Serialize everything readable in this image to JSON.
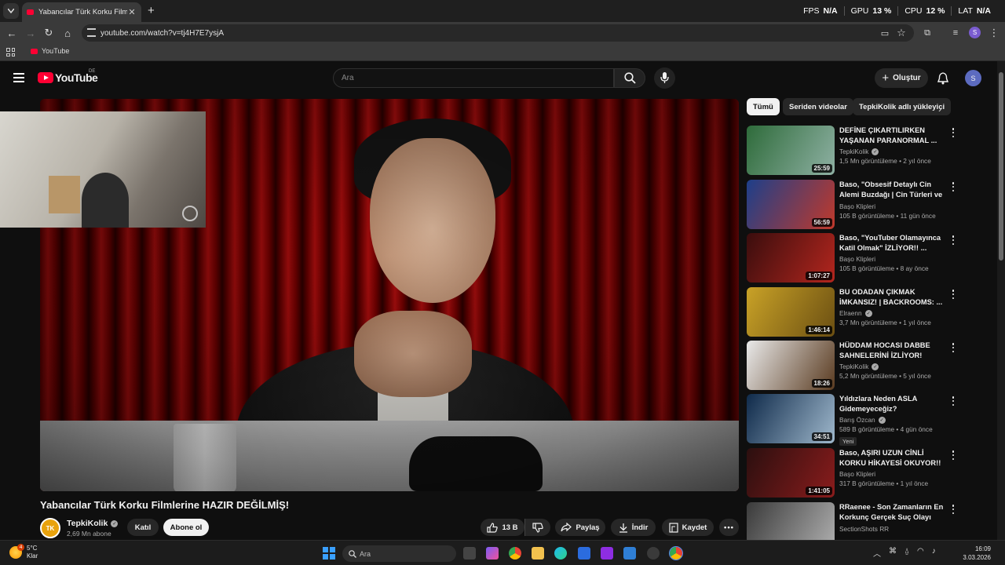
{
  "browser": {
    "tab_title": "Yabancılar Türk Korku Filmlerine HAZIR DEĞİLMİŞ!",
    "url": "youtube.com/watch?v=tj4H7E7ysjA",
    "profile_initial": "S",
    "bookmark_label": "YouTube",
    "perf": [
      {
        "label": "FPS",
        "value": "N/A"
      },
      {
        "label": "GPU",
        "value": "13 %"
      },
      {
        "label": "CPU",
        "value": "12 %"
      },
      {
        "label": "LAT",
        "value": "N/A"
      }
    ]
  },
  "youtube": {
    "logo_text": "YouTube",
    "country_code": "DE",
    "search_placeholder": "Ara",
    "create_label": "Oluştur",
    "avatar_initial": "S"
  },
  "video": {
    "title": "Yabancılar Türk Korku Filmlerine HAZIR DEĞİLMİŞ!",
    "channel": "TepkiKolik",
    "channel_initials": "TK",
    "subscribers": "2,69 Mn abone",
    "join_label": "Katıl",
    "subscribe_label": "Abone ol",
    "likes": "13 B",
    "share_label": "Paylaş",
    "download_label": "İndir",
    "save_label": "Kaydet"
  },
  "chips": [
    "Tümü",
    "Seriden videolar",
    "TepkiKolik adlı yükleyici"
  ],
  "recommendations": [
    {
      "title": "DEFİNE ÇIKARTILIRKEN YAŞANAN PARANORMAL ...",
      "channel": "TepkiKolik",
      "verified": true,
      "stats": "1,5 Mn görüntüleme • 2 yıl önce",
      "duration": "25:59",
      "badge": "",
      "color_a": "#2e6b3a",
      "color_b": "#8fb1a4"
    },
    {
      "title": "Baso, \"Obsesif Detaylı Cin Alemi Buzdağı | Cin Türleri ve ...",
      "channel": "Başo Klipleri",
      "verified": false,
      "stats": "105 B görüntüleme • 11 gün önce",
      "duration": "56:59",
      "badge": "",
      "color_a": "#1d3f8a",
      "color_b": "#c0392b"
    },
    {
      "title": "Baso, \"YouTuber Olamayınca Katil Olmak\" İZLİYOR!! ...",
      "channel": "Başo Klipleri",
      "verified": false,
      "stats": "105 B görüntüleme • 8 ay önce",
      "duration": "1:07:27",
      "badge": "",
      "color_a": "#3a0d0d",
      "color_b": "#b3261e"
    },
    {
      "title": "BU ODADAN ÇIKMAK İMKANSIZ! | BACKROOMS: ...",
      "channel": "Elraenn",
      "verified": true,
      "stats": "3,7 Mn görüntüleme • 1 yıl önce",
      "duration": "1:46:14",
      "badge": "",
      "color_a": "#c9a227",
      "color_b": "#6b4f12"
    },
    {
      "title": "HÜDDAM HOCASI DABBE SAHNELERİNİ İZLİYOR!",
      "channel": "TepkiKolik",
      "verified": true,
      "stats": "5,2 Mn görüntüleme • 5 yıl önce",
      "duration": "18:26",
      "badge": "",
      "color_a": "#e9e9e9",
      "color_b": "#5a3b20"
    },
    {
      "title": "Yıldızlara Neden ASLA Gidemeyeceğiz?",
      "channel": "Barış Özcan",
      "verified": true,
      "stats": "589 B görüntüleme • 4 gün önce",
      "duration": "34:51",
      "badge": "Yeni",
      "color_a": "#0f2a4a",
      "color_b": "#9fb8cc"
    },
    {
      "title": "Baso, AŞIRI UZUN CİNLİ KORKU HİKAYESİ OKUYOR!!",
      "channel": "Başo Klipleri",
      "verified": false,
      "stats": "317 B görüntüleme • 1 yıl önce",
      "duration": "1:41:05",
      "badge": "",
      "color_a": "#2b0f0f",
      "color_b": "#8a1c1c"
    },
    {
      "title": "RRaenee - Son Zamanların En Korkunç Gerçek Suç Olayı Tep...",
      "channel": "SectionShots RR",
      "verified": false,
      "stats": "",
      "duration": "",
      "badge": "",
      "color_a": "#3a3a3a",
      "color_b": "#b0b0b0"
    }
  ],
  "taskbar": {
    "weather_temp": "5°C",
    "weather_desc": "Klar",
    "weather_notifications": "4",
    "search_placeholder": "Ara",
    "time": "16:09",
    "date": "3.03.2026"
  }
}
